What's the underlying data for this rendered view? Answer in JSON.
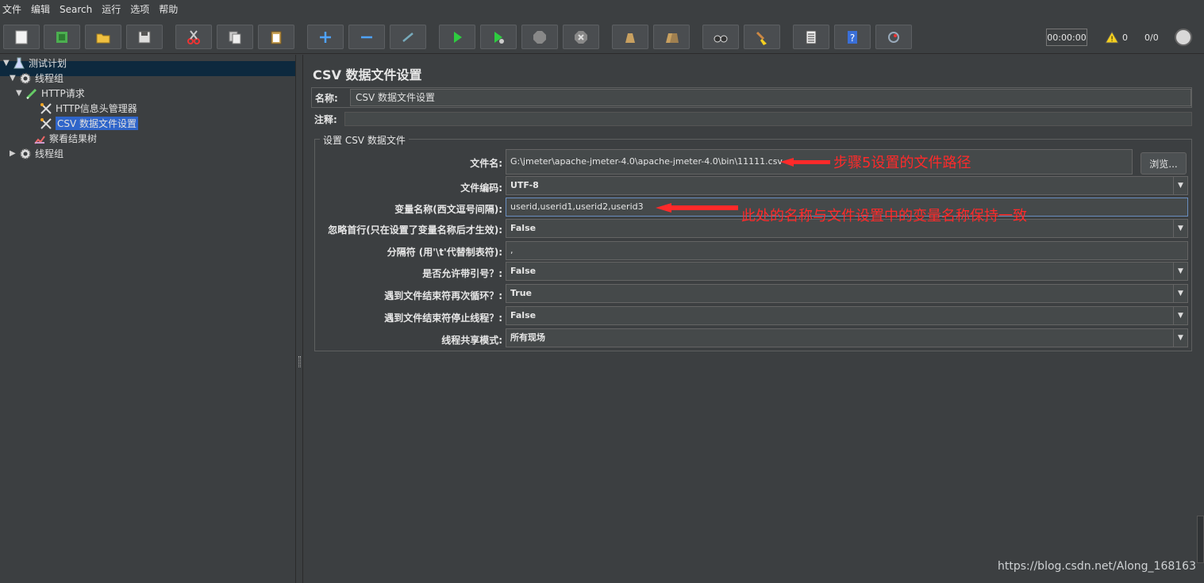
{
  "menu": [
    "文件",
    "编辑",
    "Search",
    "运行",
    "选项",
    "帮助"
  ],
  "toolbar": {
    "timer": "00:00:00",
    "warnings": "0",
    "threads": "0/0",
    "buttons": [
      "new-icon",
      "templates-icon",
      "open-icon",
      "save-icon",
      "cut-icon",
      "copy-icon",
      "paste-icon",
      "expand-icon",
      "collapse-icon",
      "toggle-icon",
      "start-icon",
      "start-no-pause-icon",
      "stop-icon",
      "shutdown-icon",
      "clear-icon",
      "clear-all-icon",
      "search-icon",
      "reset-search-icon",
      "function-helper-icon",
      "help-icon",
      "remote-icon"
    ]
  },
  "tree": [
    {
      "label": "测试计划",
      "icon": "flask-icon",
      "depth": 0,
      "toggle": "▼"
    },
    {
      "label": "线程组",
      "icon": "gear-icon",
      "depth": 1,
      "toggle": "▼"
    },
    {
      "label": "HTTP请求",
      "icon": "pipette-icon",
      "depth": 2,
      "toggle": "▼"
    },
    {
      "label": "HTTP信息头管理器",
      "icon": "wrench-icon",
      "depth": 3,
      "toggle": ""
    },
    {
      "label": "CSV 数据文件设置",
      "icon": "wrench-icon",
      "depth": 3,
      "toggle": "",
      "selected": true
    },
    {
      "label": "察看结果树",
      "icon": "chart-icon",
      "depth": 2,
      "toggle": ""
    },
    {
      "label": "线程组",
      "icon": "gear-icon",
      "depth": 1,
      "toggle": "▶"
    }
  ],
  "panel": {
    "title": "CSV 数据文件设置",
    "name_label": "名称:",
    "name_value": "CSV 数据文件设置",
    "comment_label": "注释:",
    "group_title": "设置 CSV 数据文件",
    "browse_label": "浏览...",
    "fields": {
      "filename_label": "文件名:",
      "filename_value": "G:\\jmeter\\apache-jmeter-4.0\\apache-jmeter-4.0\\bin\\11111.csv",
      "encoding_label": "文件编码:",
      "encoding_value": "UTF-8",
      "varnames_label": "变量名称(西文逗号间隔):",
      "varnames_value": "userid,userid1,userid2,userid3",
      "ignore_first_label": "忽略首行(只在设置了变量名称后才生效):",
      "ignore_first_value": "False",
      "delimiter_label": "分隔符 (用'\\t'代替制表符):",
      "delimiter_value": ",",
      "quoted_label": "是否允许带引号？:",
      "quoted_value": "False",
      "recycle_label": "遇到文件结束符再次循环？:",
      "recycle_value": "True",
      "stop_thread_label": "遇到文件结束符停止线程？:",
      "stop_thread_value": "False",
      "sharing_label": "线程共享模式:",
      "sharing_value": "所有现场"
    }
  },
  "annotations": {
    "step5": "步骤5设置的文件路径",
    "varnames_note": "此处的名称与文件设置中的变量名称保持一致"
  },
  "watermark": "https://blog.csdn.net/Along_168163",
  "colors": {
    "annotation": "#ff2a2a",
    "selection": "#2f65ca",
    "background": "#3c3f41"
  }
}
